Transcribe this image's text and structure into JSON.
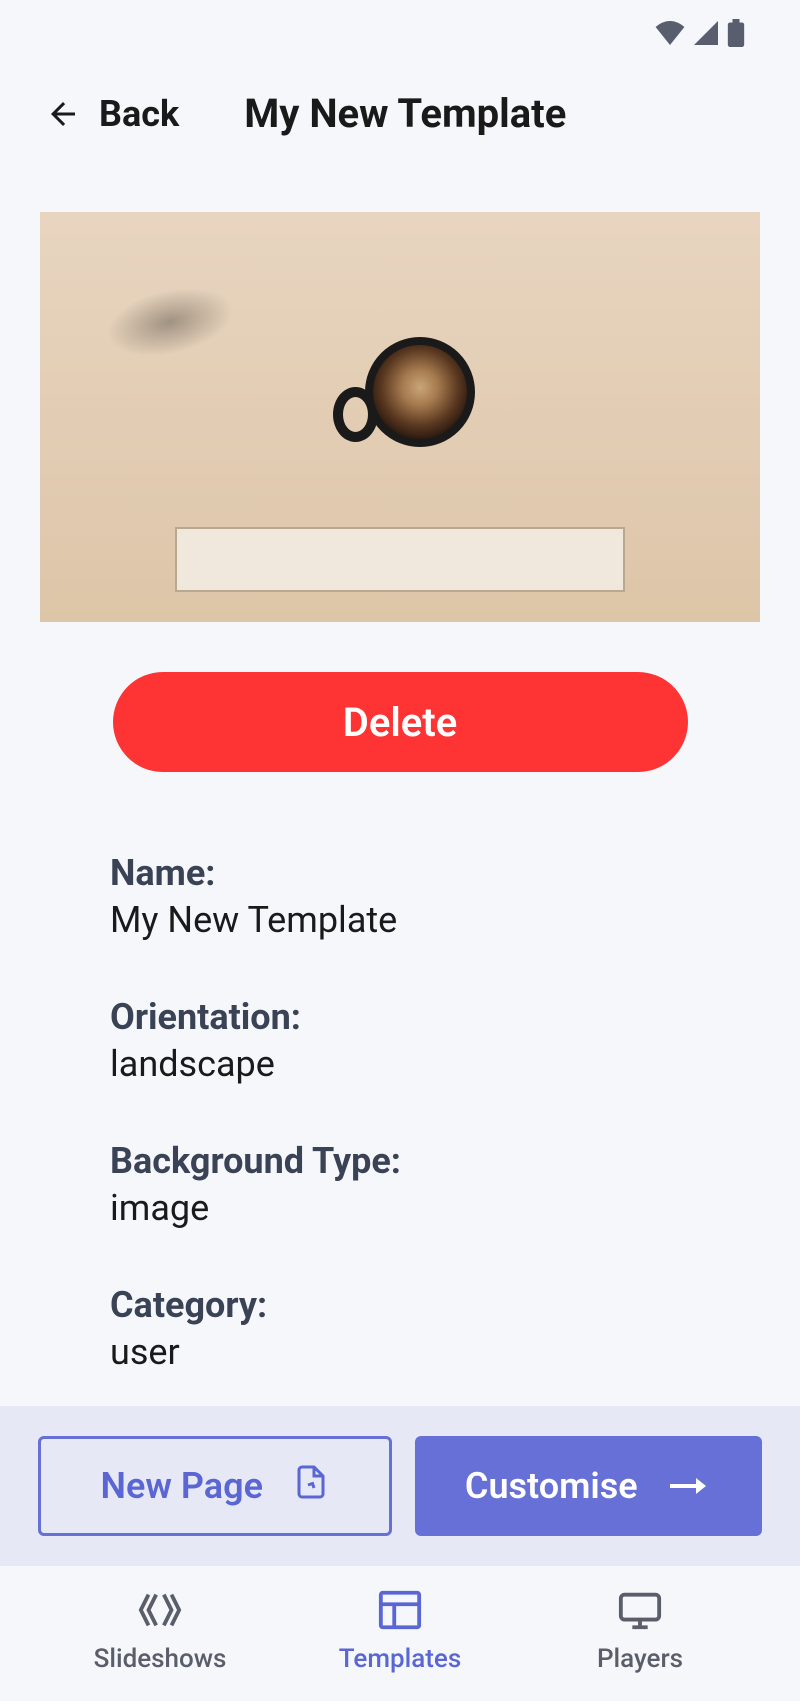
{
  "header": {
    "back_label": "Back",
    "title": "My New Template"
  },
  "actions": {
    "delete_label": "Delete"
  },
  "details": {
    "name_label": "Name:",
    "name_value": "My New Template",
    "orientation_label": "Orientation:",
    "orientation_value": "landscape",
    "bg_type_label": "Background Type:",
    "bg_type_value": "image",
    "category_label": "Category:",
    "category_value": "user"
  },
  "bottom_actions": {
    "new_page_label": "New Page",
    "customise_label": "Customise"
  },
  "nav": {
    "slideshows": "Slideshows",
    "templates": "Templates",
    "players": "Players"
  }
}
